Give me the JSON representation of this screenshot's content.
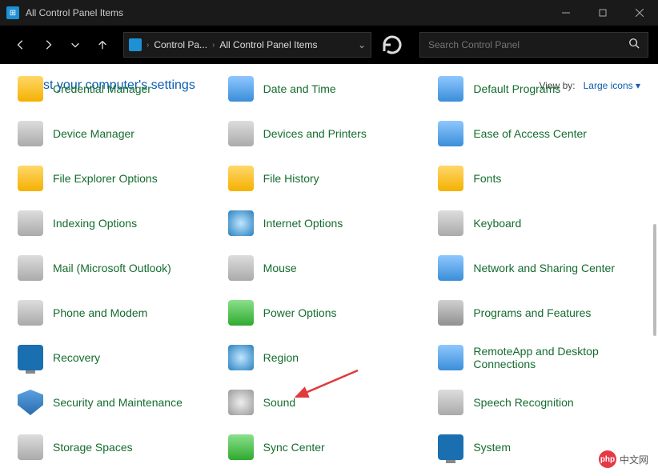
{
  "window": {
    "title": "All Control Panel Items"
  },
  "breadcrumb": {
    "seg1": "Control Pa...",
    "seg2": "All Control Panel Items"
  },
  "search": {
    "placeholder": "Search Control Panel"
  },
  "header": {
    "adjust": "Adjust your computer's settings",
    "viewby_label": "View by:",
    "viewby_value": "Large icons"
  },
  "items": [
    {
      "label": "Credential Manager",
      "slug": "credential-manager",
      "ico": "ic-folder"
    },
    {
      "label": "Date and Time",
      "slug": "date-and-time",
      "ico": "ic-blue"
    },
    {
      "label": "Default Programs",
      "slug": "default-programs",
      "ico": "ic-blue"
    },
    {
      "label": "Device Manager",
      "slug": "device-manager",
      "ico": "ic-gray"
    },
    {
      "label": "Devices and Printers",
      "slug": "devices-and-printers",
      "ico": "ic-gray"
    },
    {
      "label": "Ease of Access Center",
      "slug": "ease-of-access-center",
      "ico": "ic-blue"
    },
    {
      "label": "File Explorer Options",
      "slug": "file-explorer-options",
      "ico": "ic-folder"
    },
    {
      "label": "File History",
      "slug": "file-history",
      "ico": "ic-folder"
    },
    {
      "label": "Fonts",
      "slug": "fonts",
      "ico": "ic-folder"
    },
    {
      "label": "Indexing Options",
      "slug": "indexing-options",
      "ico": "ic-gray"
    },
    {
      "label": "Internet Options",
      "slug": "internet-options",
      "ico": "ic-globe"
    },
    {
      "label": "Keyboard",
      "slug": "keyboard",
      "ico": "ic-gray"
    },
    {
      "label": "Mail (Microsoft Outlook)",
      "slug": "mail",
      "ico": "ic-gray"
    },
    {
      "label": "Mouse",
      "slug": "mouse",
      "ico": "ic-gray"
    },
    {
      "label": "Network and Sharing Center",
      "slug": "network-sharing-center",
      "ico": "ic-blue"
    },
    {
      "label": "Phone and Modem",
      "slug": "phone-and-modem",
      "ico": "ic-gray"
    },
    {
      "label": "Power Options",
      "slug": "power-options",
      "ico": "ic-green"
    },
    {
      "label": "Programs and Features",
      "slug": "programs-and-features",
      "ico": "ic-box"
    },
    {
      "label": "Recovery",
      "slug": "recovery",
      "ico": "ic-monitor"
    },
    {
      "label": "Region",
      "slug": "region",
      "ico": "ic-globe"
    },
    {
      "label": "RemoteApp and Desktop Connections",
      "slug": "remoteapp",
      "ico": "ic-blue"
    },
    {
      "label": "Security and Maintenance",
      "slug": "security-maintenance",
      "ico": "ic-shield"
    },
    {
      "label": "Sound",
      "slug": "sound",
      "ico": "ic-sound"
    },
    {
      "label": "Speech Recognition",
      "slug": "speech-recognition",
      "ico": "ic-gray"
    },
    {
      "label": "Storage Spaces",
      "slug": "storage-spaces",
      "ico": "ic-gray"
    },
    {
      "label": "Sync Center",
      "slug": "sync-center",
      "ico": "ic-green"
    },
    {
      "label": "System",
      "slug": "system",
      "ico": "ic-monitor"
    }
  ],
  "watermark": {
    "text": "中文网",
    "badge": "php"
  }
}
